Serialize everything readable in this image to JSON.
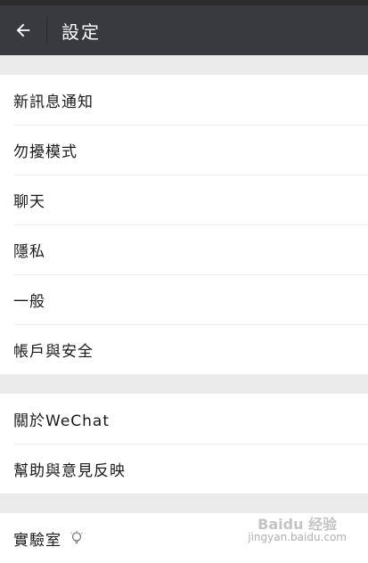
{
  "header": {
    "title": "設定",
    "back_icon": "arrow-left-icon"
  },
  "groups": [
    {
      "items": [
        {
          "name": "new-message-notification",
          "label": "新訊息通知"
        },
        {
          "name": "do-not-disturb",
          "label": "勿擾模式"
        },
        {
          "name": "chats",
          "label": "聊天"
        },
        {
          "name": "privacy",
          "label": "隱私"
        },
        {
          "name": "general",
          "label": "一般"
        },
        {
          "name": "account-security",
          "label": "帳戶與安全"
        }
      ]
    },
    {
      "items": [
        {
          "name": "about-wechat",
          "label": "關於WeChat"
        },
        {
          "name": "help-feedback",
          "label": "幫助與意見反映"
        }
      ]
    },
    {
      "items": [
        {
          "name": "labs",
          "label": "實驗室",
          "icon": "lightbulb-icon"
        }
      ]
    }
  ],
  "watermark": {
    "main": "Baidu 经验",
    "sub": "jingyan.baidu.com"
  },
  "colors": {
    "appbar": "#393a3f",
    "background": "#ebebeb",
    "item_bg": "#ffffff"
  }
}
